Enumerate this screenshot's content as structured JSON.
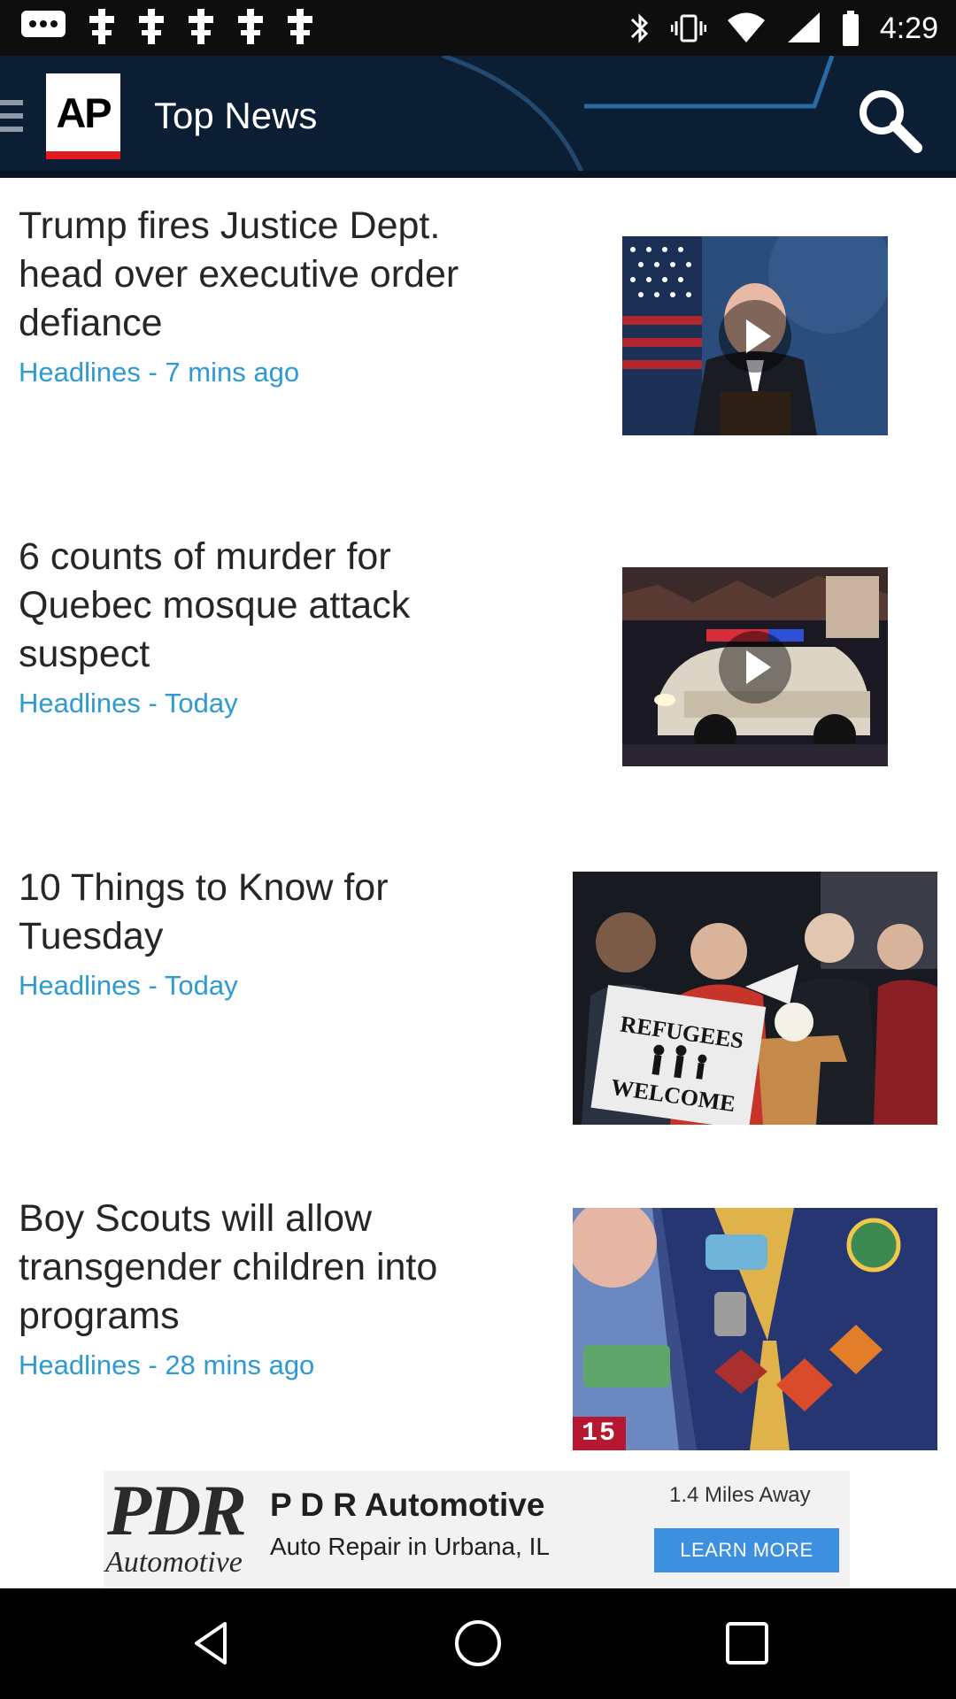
{
  "status_bar": {
    "time": "4:29",
    "left_icons": [
      "message-icon",
      "notification-icon",
      "notification-icon",
      "notification-icon",
      "notification-icon",
      "notification-icon"
    ],
    "right_icons": [
      "bluetooth-icon",
      "vibrate-icon",
      "wifi-icon",
      "signal-icon",
      "battery-icon"
    ]
  },
  "app_bar": {
    "logo_text": "AP",
    "title": "Top News",
    "menu_icon": "hamburger-menu-icon",
    "search_icon": "search-icon"
  },
  "articles": [
    {
      "headline_lines": [
        "Trump fires Justice Dept.",
        "head over executive order",
        "defiance"
      ],
      "meta": "Headlines - 7 mins ago",
      "has_video": true,
      "thumb_desc": "press-briefing"
    },
    {
      "headline_lines": [
        "6 counts of murder for",
        "Quebec mosque attack",
        "suspect"
      ],
      "meta": "Headlines - Today",
      "has_video": true,
      "thumb_desc": "police-car"
    },
    {
      "headline_lines": [
        "10 Things to Know for",
        "Tuesday"
      ],
      "meta": "Headlines - Today",
      "has_video": false,
      "thumb_desc": "rally",
      "sign_lines": [
        "REFUGEES",
        "WELCOME"
      ]
    },
    {
      "headline_lines": [
        "Boy Scouts will allow",
        "transgender children into",
        "programs"
      ],
      "meta": "Headlines - 28 mins ago",
      "has_video": false,
      "thumb_desc": "scout-uniform",
      "badge_number": "15"
    }
  ],
  "ad": {
    "logo_text_top": "PDR",
    "logo_text_bottom": "Automotive",
    "title": "P D R Automotive",
    "subtitle": "Auto Repair in Urbana, IL",
    "distance": "1.4 Miles Away",
    "cta": "LEARN MORE"
  },
  "nav_bar": {
    "buttons": [
      "back-icon",
      "home-icon",
      "recents-icon"
    ]
  },
  "colors": {
    "app_bar": "#0c1e33",
    "meta_text": "#2d9ad6",
    "ap_red": "#e21b23",
    "cta_blue": "#3d8fe0"
  }
}
